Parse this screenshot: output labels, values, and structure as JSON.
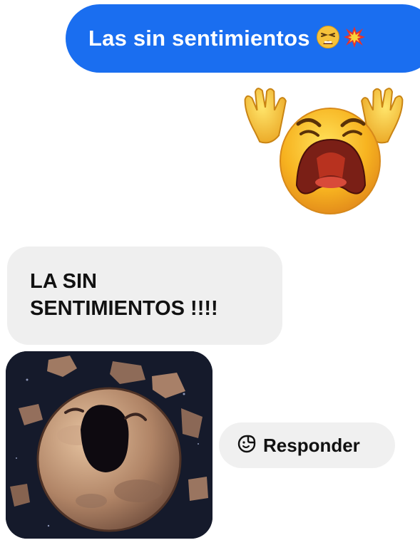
{
  "messages": {
    "outgoing": {
      "text": "Las sin sentimientos",
      "emojis": [
        "tired-face-emoji",
        "collision-emoji"
      ]
    },
    "sticker": {
      "icon": "crying-face-sticker"
    },
    "incoming": {
      "text": "LA SIN\nSENTIMIENTOS !!!!"
    },
    "image": {
      "icon": "cartoon-planet-image"
    }
  },
  "reply": {
    "label": "Responder",
    "icon": "sticker-smile-icon"
  },
  "colors": {
    "outgoing_bubble": "#1a6ef0",
    "incoming_bubble": "#efefef",
    "reply_pill": "#f0f0f0"
  }
}
